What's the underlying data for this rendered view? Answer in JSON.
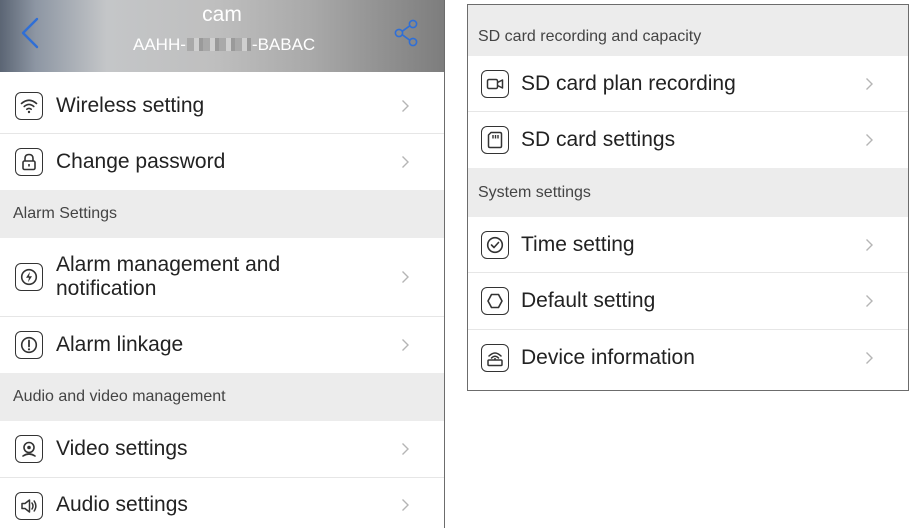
{
  "header": {
    "title": "cam",
    "device_id_prefix": "AAHH-",
    "device_id_suffix": "-BABAC"
  },
  "left": {
    "items_top": [
      {
        "label": "Wireless setting",
        "icon": "wifi-icon"
      },
      {
        "label": "Change password",
        "icon": "lock-icon"
      }
    ],
    "section_alarm": "Alarm Settings",
    "items_alarm": [
      {
        "label": "Alarm management and\nnotification",
        "icon": "alarm-bolt-icon"
      },
      {
        "label": "Alarm linkage",
        "icon": "alert-circle-icon"
      }
    ],
    "section_av": "Audio and video management",
    "items_av": [
      {
        "label": "Video settings",
        "icon": "camera-lens-icon"
      },
      {
        "label": "Audio settings",
        "icon": "speaker-icon"
      }
    ]
  },
  "right": {
    "section_sd": "SD card recording and capacity",
    "items_sd": [
      {
        "label": "SD card plan recording",
        "icon": "video-camera-icon"
      },
      {
        "label": "SD card settings",
        "icon": "sd-card-icon"
      }
    ],
    "section_system": "System settings",
    "items_system": [
      {
        "label": "Time setting",
        "icon": "clock-check-icon"
      },
      {
        "label": "Default setting",
        "icon": "hexagon-icon"
      },
      {
        "label": "Device information",
        "icon": "device-info-icon"
      }
    ]
  },
  "colors": {
    "accent": "#2f6fd6",
    "section_bg": "#ececec",
    "text": "#222222"
  }
}
